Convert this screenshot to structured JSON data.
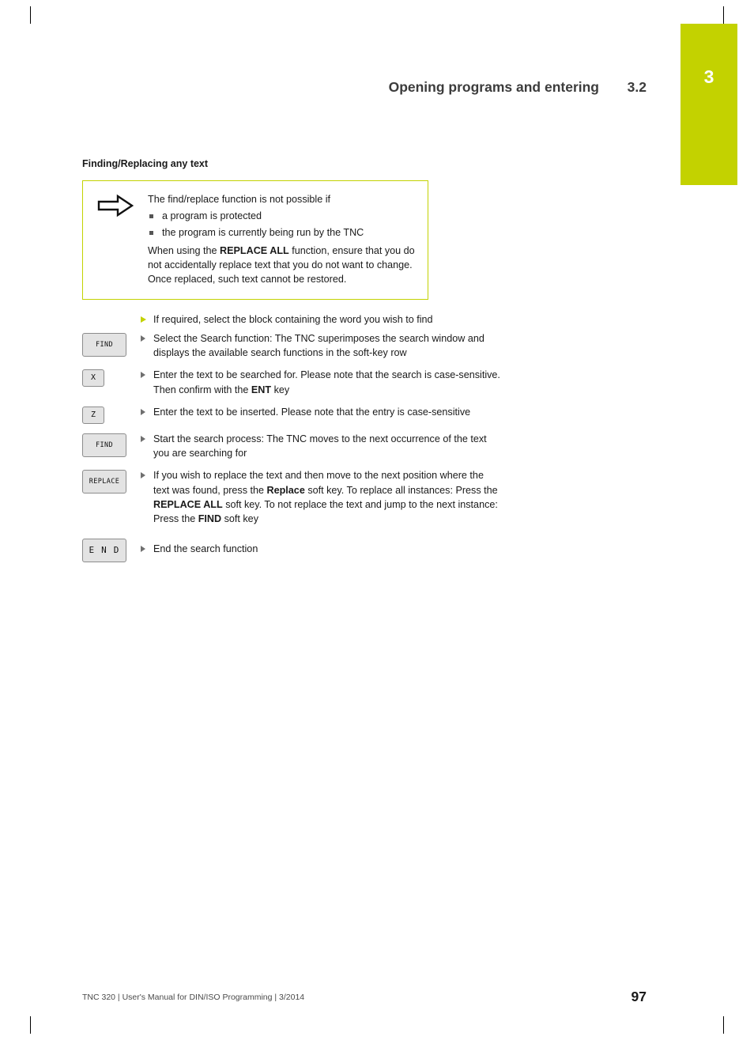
{
  "chapter_tab": {
    "number": "3",
    "color": "#c3d200"
  },
  "header": {
    "title": "Opening programs and entering",
    "section_number": "3.2"
  },
  "content": {
    "subheading": "Finding/Replacing any text",
    "note": {
      "icon": "arrow-right-note-icon",
      "intro": "The find/replace function is not possible if",
      "bullets": [
        "a program is protected",
        "the program is currently being run by the TNC"
      ],
      "paragraph_1": "When using the ",
      "paragraph_bold": "REPLACE ALL",
      "paragraph_2": " function, ensure that you do not accidentally replace text that you do not want to change. Once replaced, such text cannot be restored."
    },
    "lead_step": "If required, select the block containing the word you wish to find",
    "steps": [
      {
        "key": "FIND",
        "key_style": "wide",
        "text": "Select the Search function: The TNC superimposes the search window and displays the available search functions in the soft-key row"
      },
      {
        "key": "X",
        "key_style": "small",
        "text_1": "Enter the text to be searched for. Please note that the search is case-sensitive. Then confirm with the ",
        "text_bold": "ENT",
        "text_2": " key"
      },
      {
        "key": "Z",
        "key_style": "small",
        "text": "Enter the text to be inserted. Please note that the entry is case-sensitive"
      },
      {
        "key": "FIND",
        "key_style": "wide",
        "text": "Start the search process: The TNC moves to the next occurrence of the text you are searching for"
      },
      {
        "key": "REPLACE",
        "key_style": "wide",
        "text_1": "If you wish to replace the text and then move to the next position where the text was found, press the ",
        "text_bold_1": "Replace",
        "text_2": " soft key. To replace all instances: Press the ",
        "text_bold_2": "REPLACE ALL",
        "text_3": " soft key. To not replace the text and jump to the next instance: Press the ",
        "text_bold_3": "FIND",
        "text_4": " soft key"
      },
      {
        "key": "E N D",
        "key_style": "end",
        "text": "End the search function"
      }
    ]
  },
  "footer": {
    "left": "TNC 320 | User's Manual for DIN/ISO Programming | 3/2014",
    "page_number": "97"
  }
}
